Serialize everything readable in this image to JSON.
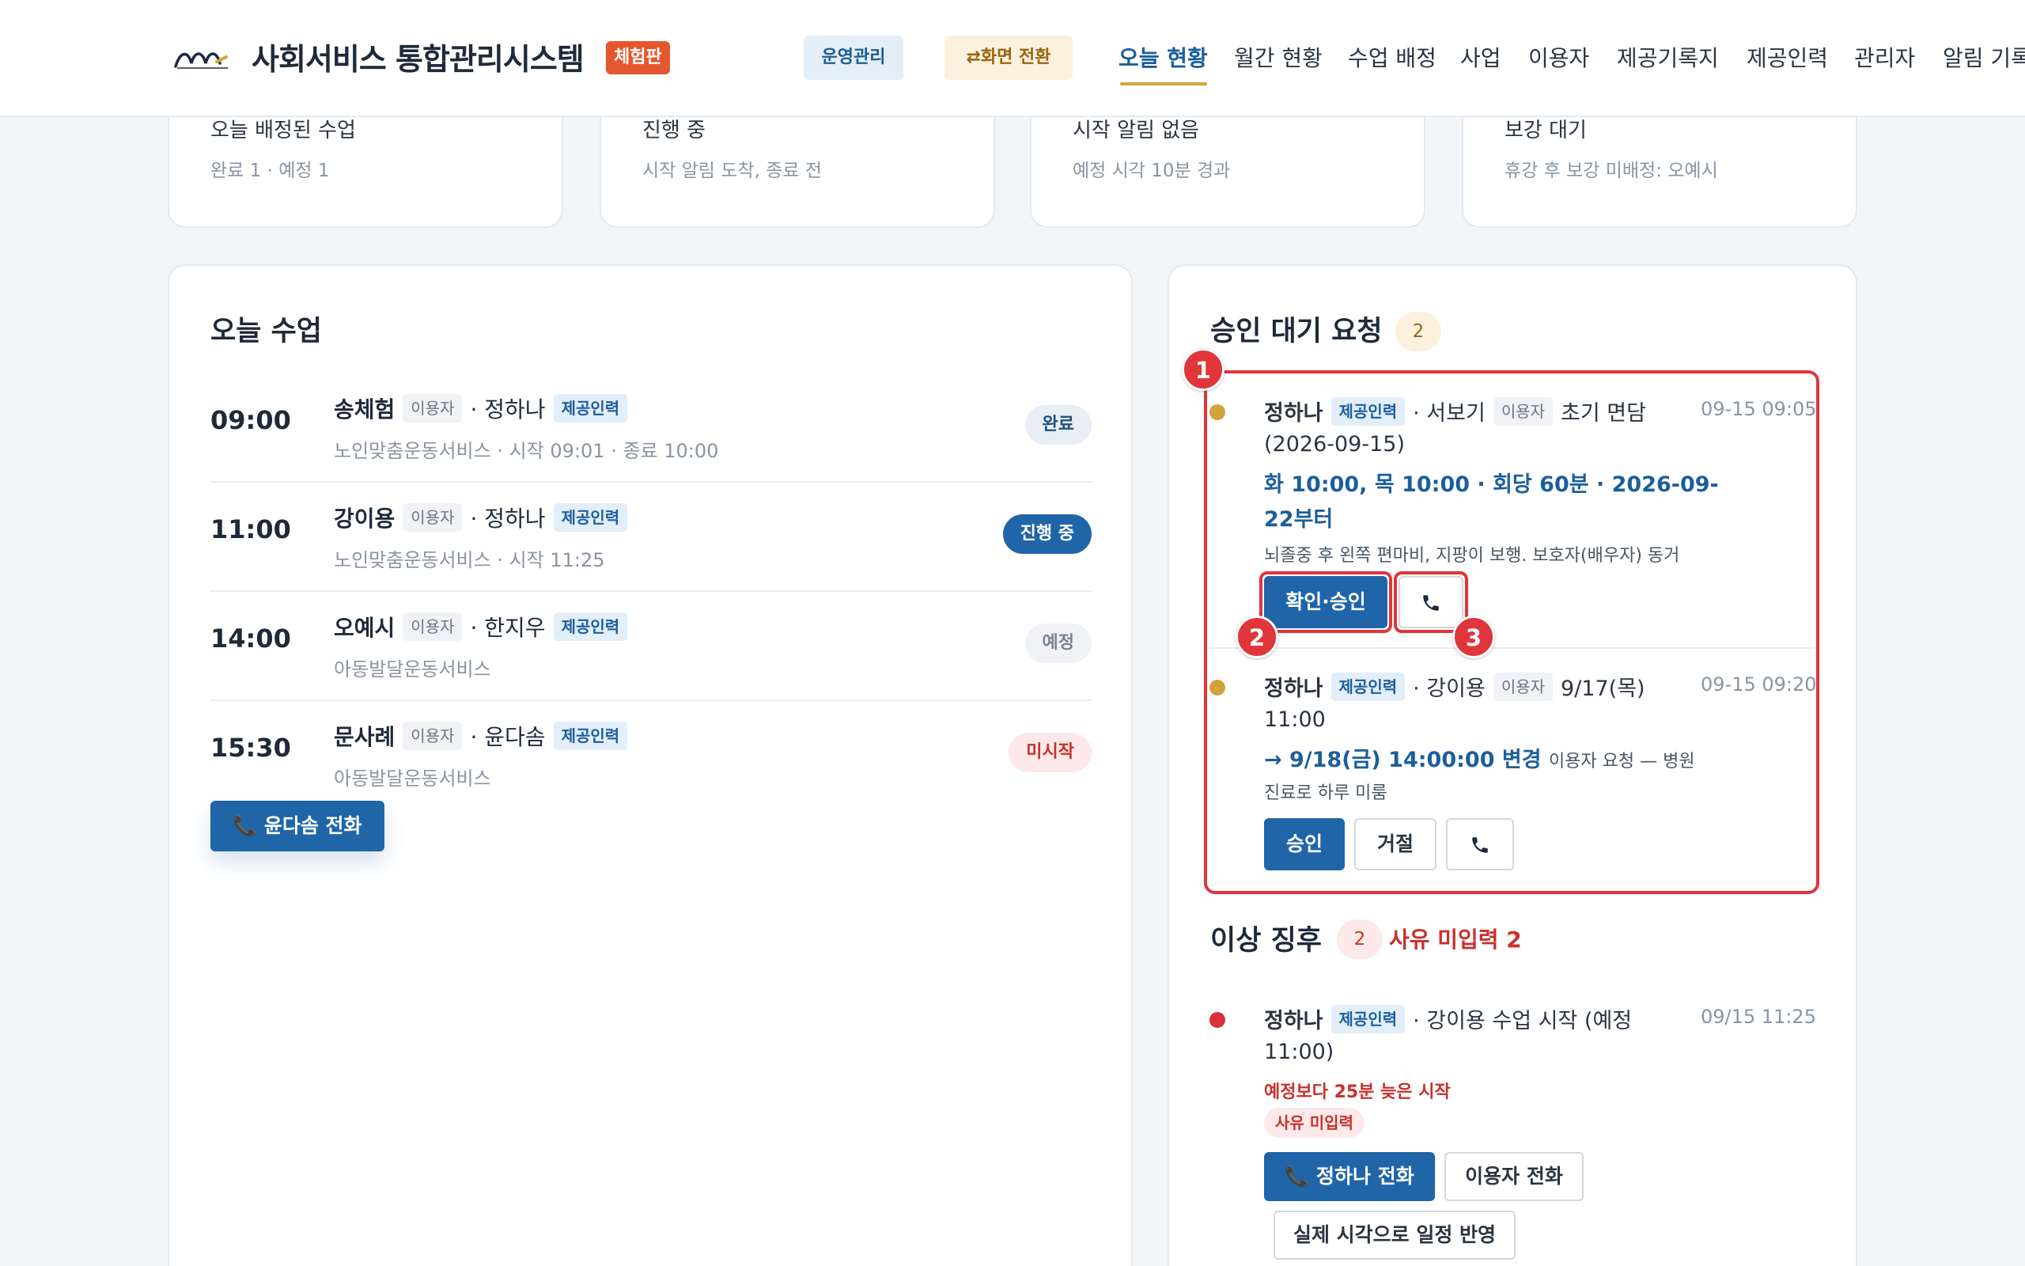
{
  "header": {
    "app_title": "사회서비스 통합관리시스템",
    "trial_badge": "체험판",
    "ops_button": "운영관리",
    "switch_button": "⇄화면 전환",
    "nav": [
      "오늘 현황",
      "월간 현황",
      "수업 배정",
      "사업",
      "이용자",
      "제공기록지",
      "제공인력",
      "관리자",
      "알림 기록"
    ]
  },
  "summary_cards": [
    {
      "title": "오늘 배정된 수업",
      "sub": "완료 1 · 예정 1"
    },
    {
      "title": "진행 중",
      "sub": "시작 알림 도착, 종료 전"
    },
    {
      "title": "시작 알림 없음",
      "sub": "예정 시각 10분 경과"
    },
    {
      "title": "보강 대기",
      "sub": "휴강 후 보강 미배정: 오예시"
    }
  ],
  "today": {
    "title": "오늘 수업",
    "tag_user": "이용자",
    "tag_staff": "제공인력",
    "lessons": [
      {
        "time": "09:00",
        "user": "송체험",
        "staff": "· 정하나",
        "detail": "노인맞춤운동서비스 · 시작 09:01 · 종료 10:00",
        "status": "완료"
      },
      {
        "time": "11:00",
        "user": "강이용",
        "staff": "· 정하나",
        "detail": "노인맞춤운동서비스 · 시작 11:25",
        "status": "진행 중"
      },
      {
        "time": "14:00",
        "user": "오예시",
        "staff": "· 한지우",
        "detail": "아동발달운동서비스",
        "status": "예정"
      },
      {
        "time": "15:30",
        "user": "문사례",
        "staff": "· 윤다솜",
        "detail": "아동발달운동서비스",
        "status": "미시작"
      }
    ],
    "call_button": "📞 윤다솜 전화"
  },
  "approvals": {
    "title": "승인 대기 요청",
    "count": "2",
    "markers": [
      "1",
      "2",
      "3"
    ],
    "req1": {
      "staff": "정하나",
      "staff_tag": "제공인력",
      "user_part": "· 서보기",
      "user_tag": "이용자",
      "type": "초기 면담",
      "date_line": "(2026-09-15)",
      "schedule_line1": "화 10:00, 목 10:00 · 회당 60분 · 2026-09-",
      "schedule_line2": "22부터",
      "note": "뇌졸중 후 왼쪽 편마비, 지팡이 보행. 보호자(배우자) 동거",
      "time": "09-15 09:05",
      "confirm_button": "확인·승인"
    },
    "req2": {
      "staff": "정하나",
      "staff_tag": "제공인력",
      "user_part": "· 강이용",
      "user_tag": "이용자",
      "orig": "9/17(목)",
      "orig_time": "11:00",
      "change": "→ 9/18(금) 14:00:00 변경",
      "reason1": "이용자 요청 — 병원",
      "reason2": "진료로 하루 미룸",
      "time": "09-15 09:20",
      "approve_button": "승인",
      "reject_button": "거절"
    }
  },
  "anomalies": {
    "title": "이상 징후",
    "count": "2",
    "missing_label": "사유 미입력 2",
    "item": {
      "staff": "정하나",
      "staff_tag": "제공인력",
      "text1": "· 강이용 수업 시작 (예정",
      "text2": "11:00)",
      "time": "09/15 11:25",
      "warning": "예정보다 25분 늦은 시작",
      "tag": "사유 미입력",
      "call_staff_button": "📞 정하나 전화",
      "call_user_button": "이용자 전화",
      "apply_button": "실제 시각으로 일정 반영"
    }
  },
  "colors": {
    "primary": "#1f65a8",
    "accent_gold": "#d4a53a",
    "danger": "#e0353b",
    "trial": "#e4572e"
  }
}
